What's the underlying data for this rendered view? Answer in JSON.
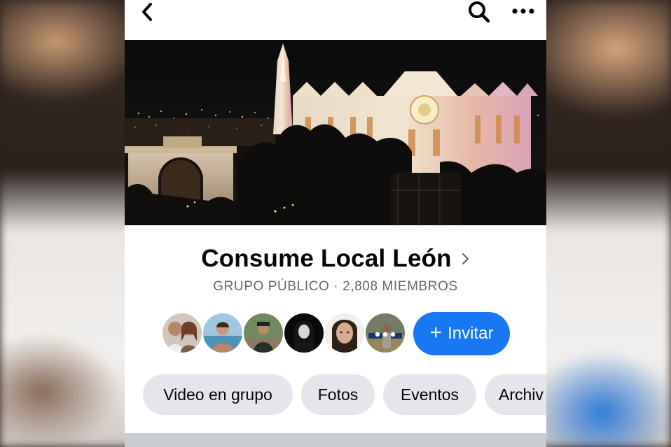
{
  "group": {
    "name": "Consume Local León",
    "subtitle": "GRUPO PÚBLICO · 2,808 MIEMBROS"
  },
  "icons": {
    "back": "chevron-left-icon",
    "search": "search-icon",
    "more": "more-horizontal-icon",
    "title_chevron": "chevron-right-icon"
  },
  "members": {
    "avatar_count": 6,
    "last_avatar_overlay": "•••"
  },
  "invite": {
    "label": "Invitar",
    "plus": "+"
  },
  "tabs": [
    {
      "label": "Video en grupo"
    },
    {
      "label": "Fotos"
    },
    {
      "label": "Eventos"
    },
    {
      "label": "Archiv"
    }
  ],
  "colors": {
    "accent": "#1877f2",
    "chip_bg": "#e4e6eb",
    "subtitle": "#65676b",
    "text": "#050505"
  }
}
